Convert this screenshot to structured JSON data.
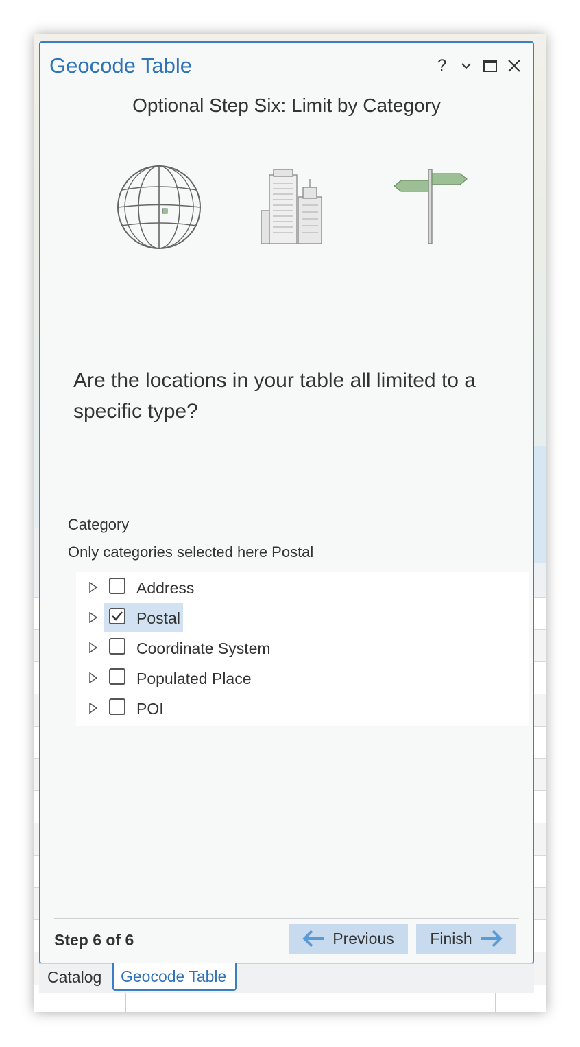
{
  "pane": {
    "title": "Geocode Table",
    "controls": {
      "help": "?",
      "dropdown_icon": "chevron-down-icon",
      "maximize_icon": "maximize-icon",
      "close_icon": "close-icon"
    }
  },
  "step_heading": "Optional Step Six: Limit by Category",
  "illustrations": [
    "globe-icon",
    "buildings-icon",
    "signpost-icon"
  ],
  "question": "Are the locations in your table all limited to a specific type?",
  "category": {
    "label": "Category",
    "subtitle": "Only categories selected here Postal",
    "items": [
      {
        "label": "Address",
        "checked": false
      },
      {
        "label": "Postal",
        "checked": true
      },
      {
        "label": "Coordinate System",
        "checked": false
      },
      {
        "label": "Populated Place",
        "checked": false
      },
      {
        "label": "POI",
        "checked": false
      }
    ]
  },
  "footer": {
    "step_count": "Step 6 of 6",
    "previous_label": "Previous",
    "finish_label": "Finish"
  },
  "tabs": [
    {
      "label": "Catalog",
      "active": false
    },
    {
      "label": "Geocode Table",
      "active": true
    }
  ],
  "colors": {
    "accent": "#2f74b8",
    "button": "#c8daee",
    "highlight": "#d3e2f3",
    "sign_green": "#9dbf95"
  }
}
